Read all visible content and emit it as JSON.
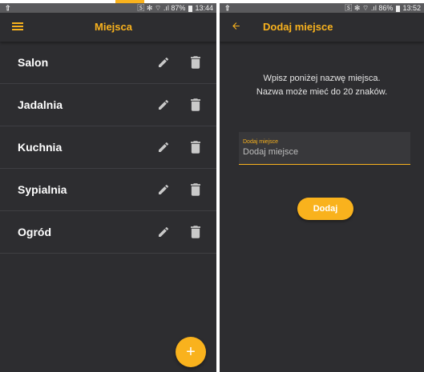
{
  "left_screen": {
    "status": {
      "upload_glyph": "⇧",
      "icons": "🅂 ✻ ⌔ .ıl",
      "battery": "87%",
      "time": "13:44"
    },
    "title": "Miejsca",
    "places": [
      {
        "label": "Salon"
      },
      {
        "label": "Jadalnia"
      },
      {
        "label": "Kuchnia"
      },
      {
        "label": "Sypialnia"
      },
      {
        "label": "Ogród"
      }
    ],
    "fab_label": "+"
  },
  "right_screen": {
    "status": {
      "upload_glyph": "⇧",
      "icons": "🅂 ✻ ⌔ .ıl",
      "battery": "86%",
      "time": "13:52"
    },
    "title": "Dodaj miejsce",
    "instructions_line1": "Wpisz poniżej nazwę miejsca.",
    "instructions_line2": "Nazwa może mieć do 20 znaków.",
    "field_label": "Dodaj miejsce",
    "field_placeholder": "Dodaj miejsce",
    "field_value": "",
    "button_label": "Dodaj"
  },
  "colors": {
    "accent": "#f9b21d",
    "background": "#2d2d30",
    "status_bar": "#5a5a5d",
    "text": "#ffffff"
  },
  "icons": [
    "menu-icon",
    "edit-icon",
    "delete-icon",
    "add-icon",
    "back-arrow-icon",
    "upload-icon"
  ]
}
